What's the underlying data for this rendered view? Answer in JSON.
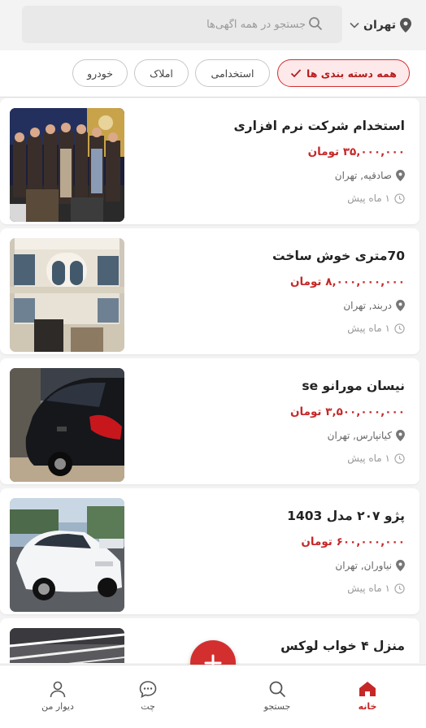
{
  "header": {
    "city_label": "تهران",
    "search_placeholder": "جستجو در همه آگهی‌ها"
  },
  "filters": {
    "all_label": "همه دسته بندی ها",
    "chips": [
      "استخدامی",
      "املاک",
      "خودرو"
    ]
  },
  "listings": [
    {
      "title": "استخدام شرکت نرم افزاری",
      "price": "۳۵,۰۰۰,۰۰۰ تومان",
      "location": "صادقیه, تهران",
      "time": "۱ ماه پیش",
      "image": "people-photo"
    },
    {
      "title": "70متری خوش ساخت",
      "price": "۸,۰۰۰,۰۰۰,۰۰۰ تومان",
      "location": "دربند, تهران",
      "time": "۱ ماه پیش",
      "image": "building-photo"
    },
    {
      "title": "نیسان مورانو se",
      "price": "۳,۵۰۰,۰۰۰,۰۰۰ تومان",
      "location": "کیانپارس, تهران",
      "time": "۱ ماه پیش",
      "image": "black-car-photo"
    },
    {
      "title": "پژو ۲۰۷ مدل 1403",
      "price": "۶۰۰,۰۰۰,۰۰۰ تومان",
      "location": "نیاوران, تهران",
      "time": "۱ ماه پیش",
      "image": "white-car-photo"
    },
    {
      "title": "منزل ۴ خواب لوکس",
      "image": "interior-photo"
    }
  ],
  "nav": {
    "home": "خانه",
    "search": "جستجو",
    "chat": "چت",
    "my_wall": "دیوار من"
  },
  "colors": {
    "accent": "#d32f2f",
    "price": "#c62828"
  },
  "icons": [
    "location-pin-icon",
    "chevron-down-icon",
    "search-icon",
    "check-icon",
    "clock-icon",
    "plus-icon",
    "home-icon",
    "chat-icon",
    "user-icon"
  ]
}
